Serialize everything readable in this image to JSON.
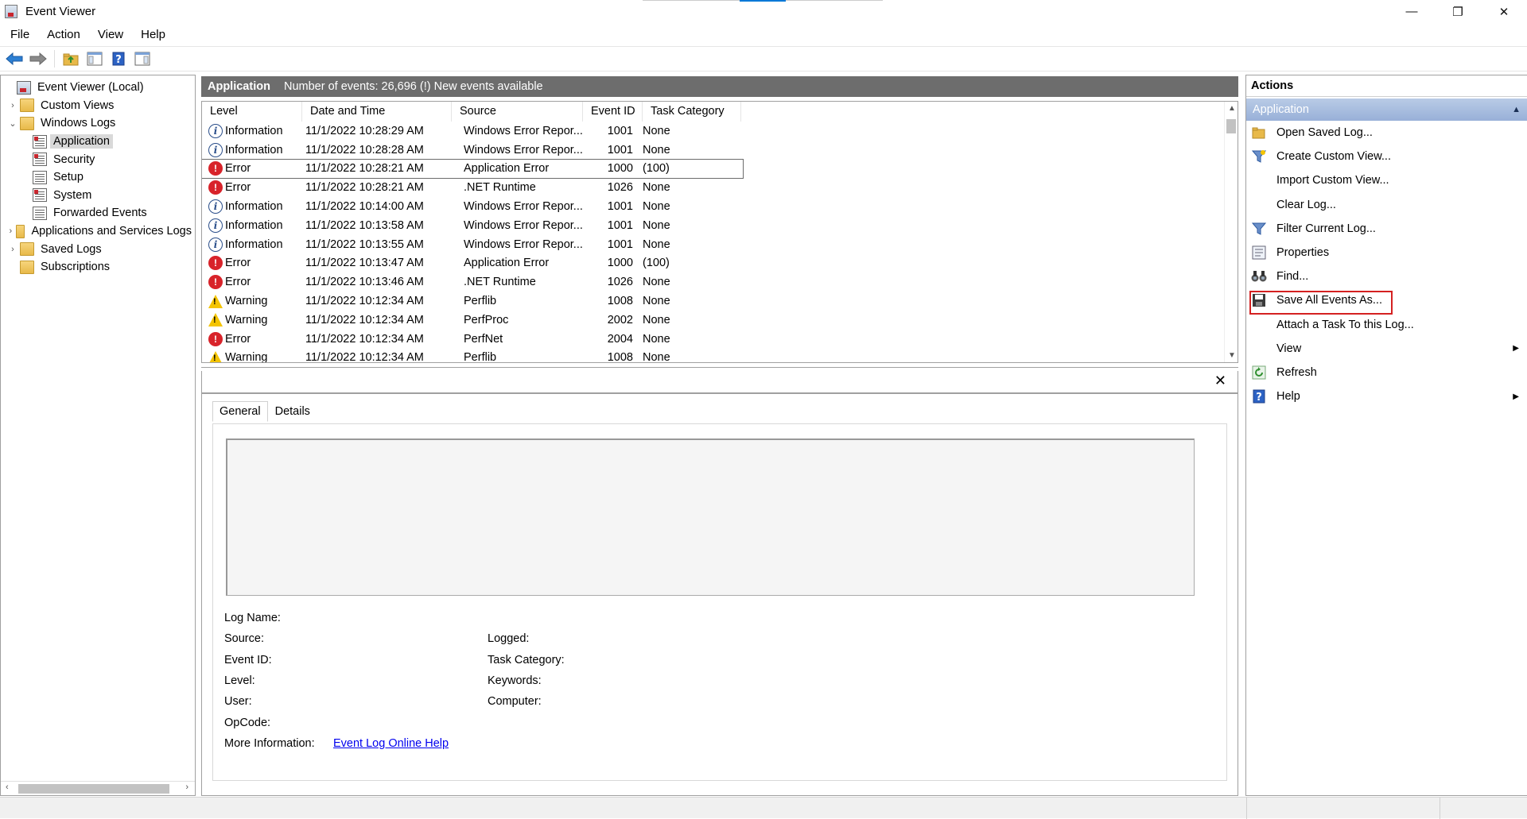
{
  "window": {
    "title": "Event Viewer",
    "minimize": "—",
    "restore": "❐",
    "close": "✕"
  },
  "menu": [
    "File",
    "Action",
    "View",
    "Help"
  ],
  "toolbar": [
    "back-icon",
    "forward-icon",
    "up-folder-icon",
    "show-hide-tree-icon",
    "help-icon",
    "show-hide-action-pane-icon"
  ],
  "tree": {
    "root": "Event Viewer (Local)",
    "custom_views": "Custom Views",
    "windows_logs": "Windows Logs",
    "application": "Application",
    "security": "Security",
    "setup": "Setup",
    "system": "System",
    "forwarded": "Forwarded Events",
    "apps_services": "Applications and Services Logs",
    "saved_logs": "Saved Logs",
    "subscriptions": "Subscriptions"
  },
  "center": {
    "title": "Application",
    "count_text": "Number of events: 26,696 (!) New events available",
    "columns": [
      "Level",
      "Date and Time",
      "Source",
      "Event ID",
      "Task Category"
    ],
    "rows": [
      {
        "level": "Information",
        "date": "11/1/2022 10:28:29 AM",
        "source": "Windows Error Repor...",
        "id": "1001",
        "category": "None"
      },
      {
        "level": "Information",
        "date": "11/1/2022 10:28:28 AM",
        "source": "Windows Error Repor...",
        "id": "1001",
        "category": "None"
      },
      {
        "level": "Error",
        "date": "11/1/2022 10:28:21 AM",
        "source": "Application Error",
        "id": "1000",
        "category": "(100)"
      },
      {
        "level": "Error",
        "date": "11/1/2022 10:28:21 AM",
        "source": ".NET Runtime",
        "id": "1026",
        "category": "None"
      },
      {
        "level": "Information",
        "date": "11/1/2022 10:14:00 AM",
        "source": "Windows Error Repor...",
        "id": "1001",
        "category": "None"
      },
      {
        "level": "Information",
        "date": "11/1/2022 10:13:58 AM",
        "source": "Windows Error Repor...",
        "id": "1001",
        "category": "None"
      },
      {
        "level": "Information",
        "date": "11/1/2022 10:13:55 AM",
        "source": "Windows Error Repor...",
        "id": "1001",
        "category": "None"
      },
      {
        "level": "Error",
        "date": "11/1/2022 10:13:47 AM",
        "source": "Application Error",
        "id": "1000",
        "category": "(100)"
      },
      {
        "level": "Error",
        "date": "11/1/2022 10:13:46 AM",
        "source": ".NET Runtime",
        "id": "1026",
        "category": "None"
      },
      {
        "level": "Warning",
        "date": "11/1/2022 10:12:34 AM",
        "source": "Perflib",
        "id": "1008",
        "category": "None"
      },
      {
        "level": "Warning",
        "date": "11/1/2022 10:12:34 AM",
        "source": "PerfProc",
        "id": "2002",
        "category": "None"
      },
      {
        "level": "Error",
        "date": "11/1/2022 10:12:34 AM",
        "source": "PerfNet",
        "id": "2004",
        "category": "None"
      },
      {
        "level": "Warning",
        "date": "11/1/2022 10:12:34 AM",
        "source": "Perflib",
        "id": "1008",
        "category": "None"
      }
    ]
  },
  "detail": {
    "tabs": [
      "General",
      "Details"
    ],
    "log_name": "Log Name:",
    "source": "Source:",
    "event_id": "Event ID:",
    "level": "Level:",
    "user": "User:",
    "opcode": "OpCode:",
    "more_info": "More Information:",
    "logged": "Logged:",
    "task_category": "Task Category:",
    "keywords": "Keywords:",
    "computer": "Computer:",
    "help_link": "Event Log Online Help"
  },
  "actions": {
    "title": "Actions",
    "section": "Application",
    "items": [
      {
        "label": "Open Saved Log...",
        "icon": "open-folder-icon"
      },
      {
        "label": "Create Custom View...",
        "icon": "filter-star-icon"
      },
      {
        "label": "Import Custom View...",
        "icon": ""
      },
      {
        "label": "Clear Log...",
        "icon": ""
      },
      {
        "label": "Filter Current Log...",
        "icon": "filter-icon"
      },
      {
        "label": "Properties",
        "icon": "properties-icon"
      },
      {
        "label": "Find...",
        "icon": "binoculars-icon"
      },
      {
        "label": "Save All Events As...",
        "icon": "save-icon"
      },
      {
        "label": "Attach a Task To this Log...",
        "icon": ""
      },
      {
        "label": "View",
        "icon": ""
      },
      {
        "label": "Refresh",
        "icon": "refresh-icon"
      },
      {
        "label": "Help",
        "icon": "help-icon"
      }
    ]
  }
}
